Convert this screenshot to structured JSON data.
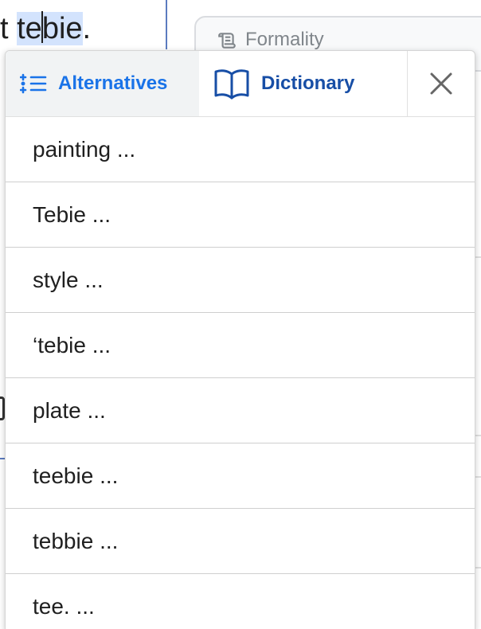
{
  "editor": {
    "text_before": "t ",
    "selected_before_caret": "te",
    "selected_after_caret": "bie",
    "text_after": "."
  },
  "formality": {
    "label": "Formality",
    "icon": "scroll-icon"
  },
  "popup": {
    "tabs": [
      {
        "label": "Alternatives",
        "icon": "list-alternatives-icon",
        "active": false,
        "color": "#1a73e8"
      },
      {
        "label": "Dictionary",
        "icon": "book-icon",
        "active": true,
        "color": "#174ea6"
      }
    ],
    "close_icon": "close-icon",
    "items": [
      {
        "label": "painting ..."
      },
      {
        "label": "Tebie ..."
      },
      {
        "label": "style ..."
      },
      {
        "label": "‘tebie ..."
      },
      {
        "label": "plate ..."
      },
      {
        "label": "teebie ..."
      },
      {
        "label": "tebbie ..."
      },
      {
        "label": "tee. ..."
      }
    ]
  }
}
